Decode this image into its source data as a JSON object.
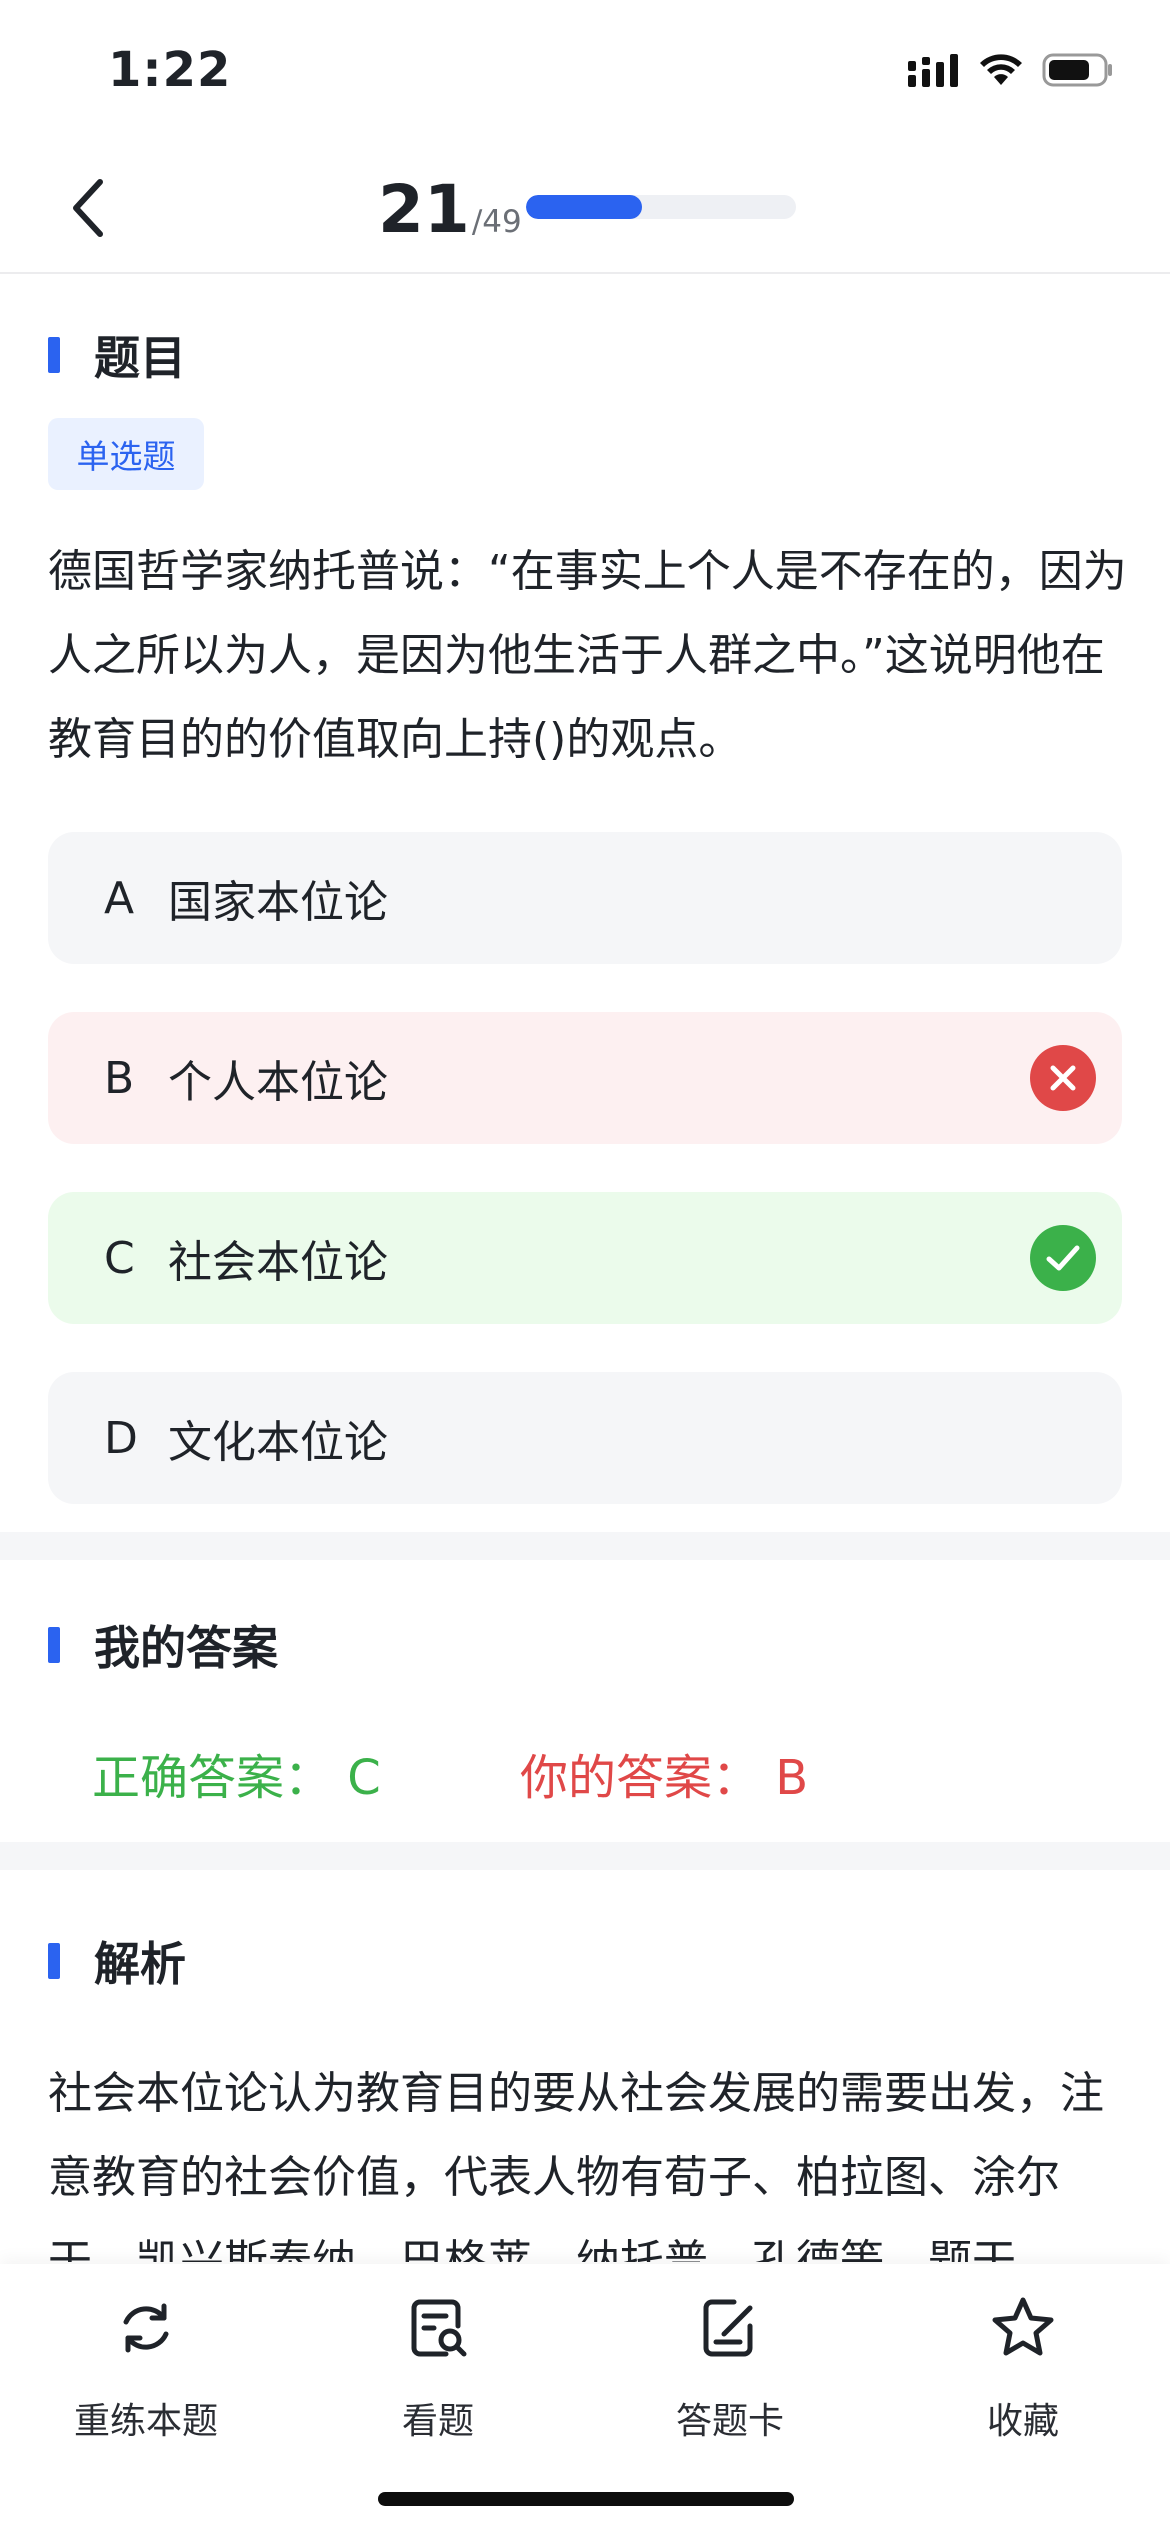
{
  "status_bar": {
    "time": "1:22",
    "icons": [
      "signal-icon",
      "wifi-icon",
      "battery-icon"
    ]
  },
  "header": {
    "back_icon": "chevron-left-icon",
    "current": "21",
    "total": "/49",
    "progress_fraction": 0.43
  },
  "question_section": {
    "title": "题目",
    "type_badge": "单选题",
    "text": "德国哲学家纳托普说：“在事实上个人是不存在的，因为人之所以为人，是因为他生活于人群之中。”这说明他在教育目的的价值取向上持()的观点。",
    "options": [
      {
        "letter": "A",
        "text": "国家本位论",
        "state": "neutral"
      },
      {
        "letter": "B",
        "text": "个人本位论",
        "state": "wrong"
      },
      {
        "letter": "C",
        "text": "社会本位论",
        "state": "correct"
      },
      {
        "letter": "D",
        "text": "文化本位论",
        "state": "neutral"
      }
    ]
  },
  "my_answer_section": {
    "title": "我的答案",
    "correct_answer": "正确答案：  C",
    "your_answer": "你的答案：  B"
  },
  "analysis_section": {
    "title": "解析",
    "text": "社会本位论认为教育目的要从社会发展的需要出发，注意教育的社会价值，代表人物有荀子、柏拉图、涂尔干、凯兴斯泰纳、巴格莱、纳托普、孔德等。题干"
  },
  "toolbar": {
    "items": [
      {
        "label": "重练本题",
        "icon": "refresh-icon"
      },
      {
        "label": "看题",
        "icon": "view-question-icon"
      },
      {
        "label": "答题卡",
        "icon": "answer-card-icon"
      },
      {
        "label": "收藏",
        "icon": "star-icon"
      }
    ]
  },
  "colors": {
    "accent": "#2b63f0",
    "wrong": "#e04848",
    "correct": "#3bb14a"
  }
}
